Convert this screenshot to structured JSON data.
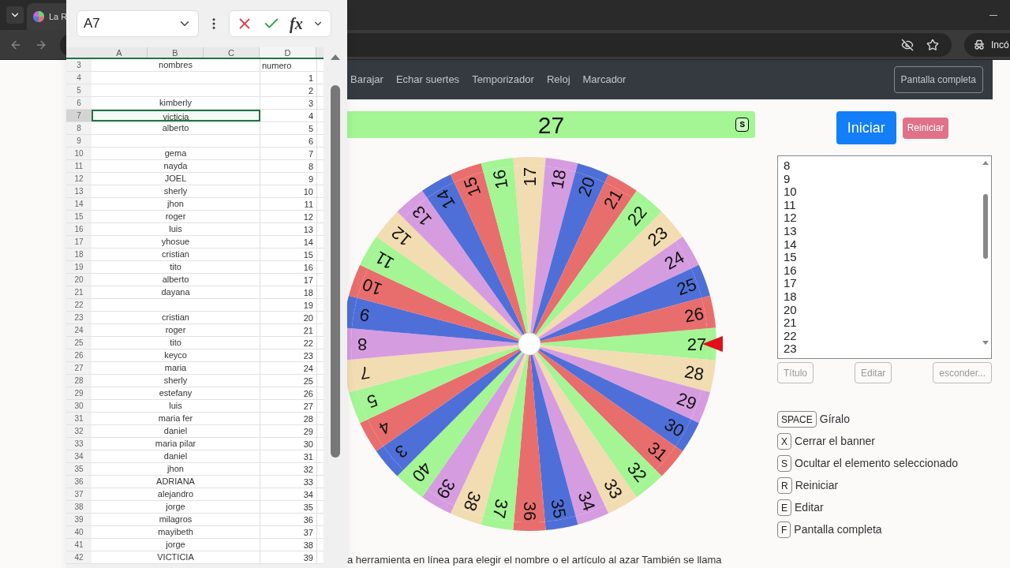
{
  "browser": {
    "tabs": [
      {
        "title": "La R"
      }
    ],
    "profile": "Incó"
  },
  "sheet": {
    "name_box": "A7",
    "function_label": "fx",
    "columns": [
      "A",
      "B",
      "C",
      "D"
    ],
    "rows": [
      {
        "number": "3",
        "kind": "header",
        "name": "nombres",
        "value": "numero",
        "selected": false
      },
      {
        "number": "4",
        "kind": "data",
        "name": "",
        "value": "1",
        "selected": false
      },
      {
        "number": "5",
        "kind": "data",
        "name": "",
        "value": "2",
        "selected": false
      },
      {
        "number": "6",
        "kind": "data",
        "name": "kimberly",
        "value": "3",
        "selected": false
      },
      {
        "number": "7",
        "kind": "data",
        "name": "victicia",
        "value": "4",
        "selected": true
      },
      {
        "number": "8",
        "kind": "data",
        "name": "alberto",
        "value": "5",
        "selected": false
      },
      {
        "number": "9",
        "kind": "data",
        "name": "",
        "value": "6",
        "selected": false
      },
      {
        "number": "10",
        "kind": "data",
        "name": "gema",
        "value": "7",
        "selected": false
      },
      {
        "number": "11",
        "kind": "data",
        "name": "nayda",
        "value": "8",
        "selected": false
      },
      {
        "number": "12",
        "kind": "data",
        "name": "JOEL",
        "value": "9",
        "selected": false
      },
      {
        "number": "13",
        "kind": "data",
        "name": "sherly",
        "value": "10",
        "selected": false
      },
      {
        "number": "14",
        "kind": "data",
        "name": "jhon",
        "value": "11",
        "selected": false
      },
      {
        "number": "15",
        "kind": "data",
        "name": "roger",
        "value": "12",
        "selected": false
      },
      {
        "number": "16",
        "kind": "data",
        "name": "luis",
        "value": "13",
        "selected": false
      },
      {
        "number": "17",
        "kind": "data",
        "name": "yhosue",
        "value": "14",
        "selected": false
      },
      {
        "number": "18",
        "kind": "data",
        "name": "cristian",
        "value": "15",
        "selected": false
      },
      {
        "number": "19",
        "kind": "data",
        "name": "tito",
        "value": "16",
        "selected": false
      },
      {
        "number": "20",
        "kind": "data",
        "name": "alberto",
        "value": "17",
        "selected": false
      },
      {
        "number": "21",
        "kind": "data",
        "name": "dayana",
        "value": "18",
        "selected": false
      },
      {
        "number": "22",
        "kind": "data",
        "name": "",
        "value": "19",
        "selected": false
      },
      {
        "number": "23",
        "kind": "data",
        "name": "cristian",
        "value": "20",
        "selected": false
      },
      {
        "number": "24",
        "kind": "data",
        "name": "roger",
        "value": "21",
        "selected": false
      },
      {
        "number": "25",
        "kind": "data",
        "name": "tito",
        "value": "22",
        "selected": false
      },
      {
        "number": "26",
        "kind": "data",
        "name": "keyco",
        "value": "23",
        "selected": false
      },
      {
        "number": "27",
        "kind": "data",
        "name": "maria",
        "value": "24",
        "selected": false
      },
      {
        "number": "28",
        "kind": "data",
        "name": "sherly",
        "value": "25",
        "selected": false
      },
      {
        "number": "29",
        "kind": "data",
        "name": "estefany",
        "value": "26",
        "selected": false
      },
      {
        "number": "30",
        "kind": "data",
        "name": "luis",
        "value": "27",
        "selected": false
      },
      {
        "number": "31",
        "kind": "data",
        "name": "maria fer",
        "value": "28",
        "selected": false
      },
      {
        "number": "32",
        "kind": "data",
        "name": "daniel",
        "value": "29",
        "selected": false
      },
      {
        "number": "33",
        "kind": "data",
        "name": "maria pilar",
        "value": "30",
        "selected": false
      },
      {
        "number": "34",
        "kind": "data",
        "name": "daniel",
        "value": "31",
        "selected": false
      },
      {
        "number": "35",
        "kind": "data",
        "name": "jhon",
        "value": "32",
        "selected": false
      },
      {
        "number": "36",
        "kind": "data",
        "name": "ADRIANA",
        "value": "33",
        "selected": false
      },
      {
        "number": "37",
        "kind": "data",
        "name": "alejandro",
        "value": "34",
        "selected": false
      },
      {
        "number": "38",
        "kind": "data",
        "name": "jorge",
        "value": "35",
        "selected": false
      },
      {
        "number": "39",
        "kind": "data",
        "name": "milagros",
        "value": "36",
        "selected": false
      },
      {
        "number": "40",
        "kind": "data",
        "name": "mayibeth",
        "value": "37",
        "selected": false
      },
      {
        "number": "41",
        "kind": "data",
        "name": "jorge",
        "value": "38",
        "selected": false
      },
      {
        "number": "42",
        "kind": "data",
        "name": "VICTICIA",
        "value": "39",
        "selected": false
      }
    ]
  },
  "nav": {
    "items": [
      "Barajar",
      "Echar suertes",
      "Temporizador",
      "Reloj",
      "Marcador"
    ],
    "fullscreen": "Pantalla completa"
  },
  "result": {
    "value": "27",
    "key": "S"
  },
  "wheel": {
    "segments": [
      {
        "label": "27",
        "color": "#a4f594"
      },
      {
        "label": "28",
        "color": "#f2dcb2"
      },
      {
        "label": "29",
        "color": "#d69ce0"
      },
      {
        "label": "30",
        "color": "#4f6fd8"
      },
      {
        "label": "31",
        "color": "#e86e6e"
      },
      {
        "label": "32",
        "color": "#a4f594"
      },
      {
        "label": "33",
        "color": "#f2dcb2"
      },
      {
        "label": "34",
        "color": "#d69ce0"
      },
      {
        "label": "35",
        "color": "#4f6fd8"
      },
      {
        "label": "36",
        "color": "#e86e6e"
      },
      {
        "label": "37",
        "color": "#a4f594"
      },
      {
        "label": "38",
        "color": "#f2dcb2"
      },
      {
        "label": "39",
        "color": "#d69ce0"
      },
      {
        "label": "40",
        "color": "#a4f594"
      },
      {
        "label": "3",
        "color": "#4f6fd8"
      },
      {
        "label": "4",
        "color": "#e86e6e"
      },
      {
        "label": "5",
        "color": "#a4f594"
      },
      {
        "label": "7",
        "color": "#f2dcb2"
      },
      {
        "label": "8",
        "color": "#d69ce0"
      },
      {
        "label": "9",
        "color": "#4f6fd8"
      },
      {
        "label": "10",
        "color": "#e86e6e"
      },
      {
        "label": "11",
        "color": "#a4f594"
      },
      {
        "label": "12",
        "color": "#f2dcb2"
      },
      {
        "label": "13",
        "color": "#d69ce0"
      },
      {
        "label": "14",
        "color": "#4f6fd8"
      },
      {
        "label": "15",
        "color": "#e86e6e"
      },
      {
        "label": "16",
        "color": "#a4f594"
      },
      {
        "label": "17",
        "color": "#f2dcb2"
      },
      {
        "label": "18",
        "color": "#d69ce0"
      },
      {
        "label": "20",
        "color": "#4f6fd8"
      },
      {
        "label": "21",
        "color": "#e86e6e"
      },
      {
        "label": "22",
        "color": "#a4f594"
      },
      {
        "label": "23",
        "color": "#f2dcb2"
      },
      {
        "label": "24",
        "color": "#d69ce0"
      },
      {
        "label": "25",
        "color": "#4f6fd8"
      },
      {
        "label": "26",
        "color": "#e86e6e"
      }
    ]
  },
  "controls": {
    "start": "Iniciar",
    "reset": "Reiniciar"
  },
  "entries": [
    "8",
    "9",
    "10",
    "11",
    "12",
    "13",
    "14",
    "15",
    "16",
    "17",
    "18",
    "20",
    "21",
    "22",
    "23"
  ],
  "list_buttons": [
    "Título",
    "Editar",
    "esconder..."
  ],
  "shortcuts": [
    {
      "key": "SPACE",
      "label": "Gíralo"
    },
    {
      "key": "X",
      "label": "Cerrar el banner"
    },
    {
      "key": "S",
      "label": "Ocultar el elemento seleccionado"
    },
    {
      "key": "R",
      "label": "Reiniciar"
    },
    {
      "key": "E",
      "label": "Editar"
    },
    {
      "key": "F",
      "label": "Pantalla completa"
    }
  ],
  "footer": "a herramienta en línea para elegir el nombre o el artículo al azar También se llama"
}
